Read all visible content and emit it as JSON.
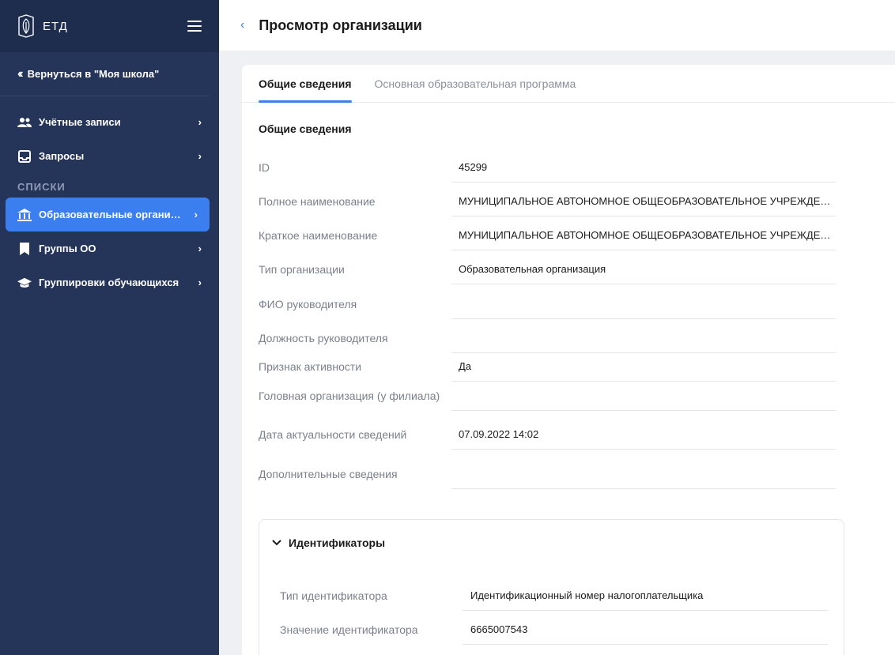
{
  "app": {
    "logo_text": "ЕТД"
  },
  "sidebar": {
    "back_label": "Вернуться в \"Моя школа\"",
    "items_top": [
      {
        "label": "Учётные записи",
        "icon": "users-icon"
      },
      {
        "label": "Запросы",
        "icon": "inbox-icon"
      }
    ],
    "section_title": "СПИСКИ",
    "items_lists": [
      {
        "label": "Образовательные организа...",
        "icon": "institution-icon",
        "active": true
      },
      {
        "label": "Группы ОО",
        "icon": "bookmark-icon"
      },
      {
        "label": "Группировки обучающихся",
        "icon": "graduation-cap-icon"
      }
    ]
  },
  "header": {
    "title": "Просмотр организации"
  },
  "tabs": [
    {
      "label": "Общие сведения",
      "active": true
    },
    {
      "label": "Основная образовательная программа"
    }
  ],
  "general": {
    "title": "Общие сведения",
    "fields": [
      {
        "label": "ID",
        "value": "45299"
      },
      {
        "label": "Полное наименование",
        "value": "МУНИЦИПАЛЬНОЕ АВТОНОМНОЕ ОБЩЕОБРАЗОВАТЕЛЬНОЕ УЧРЕЖДЕН..."
      },
      {
        "label": "Краткое наименование",
        "value": "МУНИЦИПАЛЬНОЕ АВТОНОМНОЕ ОБЩЕОБРАЗОВАТЕЛЬНОЕ УЧРЕЖДЕН..."
      },
      {
        "label": "Тип организации",
        "value": "Образовательная организация"
      },
      {
        "label": "ФИО руководителя",
        "value": ""
      },
      {
        "label": "Должность руководителя",
        "value": ""
      },
      {
        "label": "Признак активности",
        "value": "Да"
      },
      {
        "label": "Головная организация (у филиала)",
        "value": ""
      },
      {
        "label": "Дата актуальности сведений",
        "value": "07.09.2022 14:02"
      },
      {
        "label": "Дополнительные сведения",
        "value": ""
      }
    ]
  },
  "identifiers": {
    "title": "Идентификаторы",
    "fields": [
      {
        "label": "Тип идентификатора",
        "value": "Идентификационный номер налогоплательщика"
      },
      {
        "label": "Значение идентификатора",
        "value": "6665007543"
      }
    ]
  },
  "colors": {
    "sidebar_bg": "#25355a",
    "accent": "#3b7ef0"
  }
}
